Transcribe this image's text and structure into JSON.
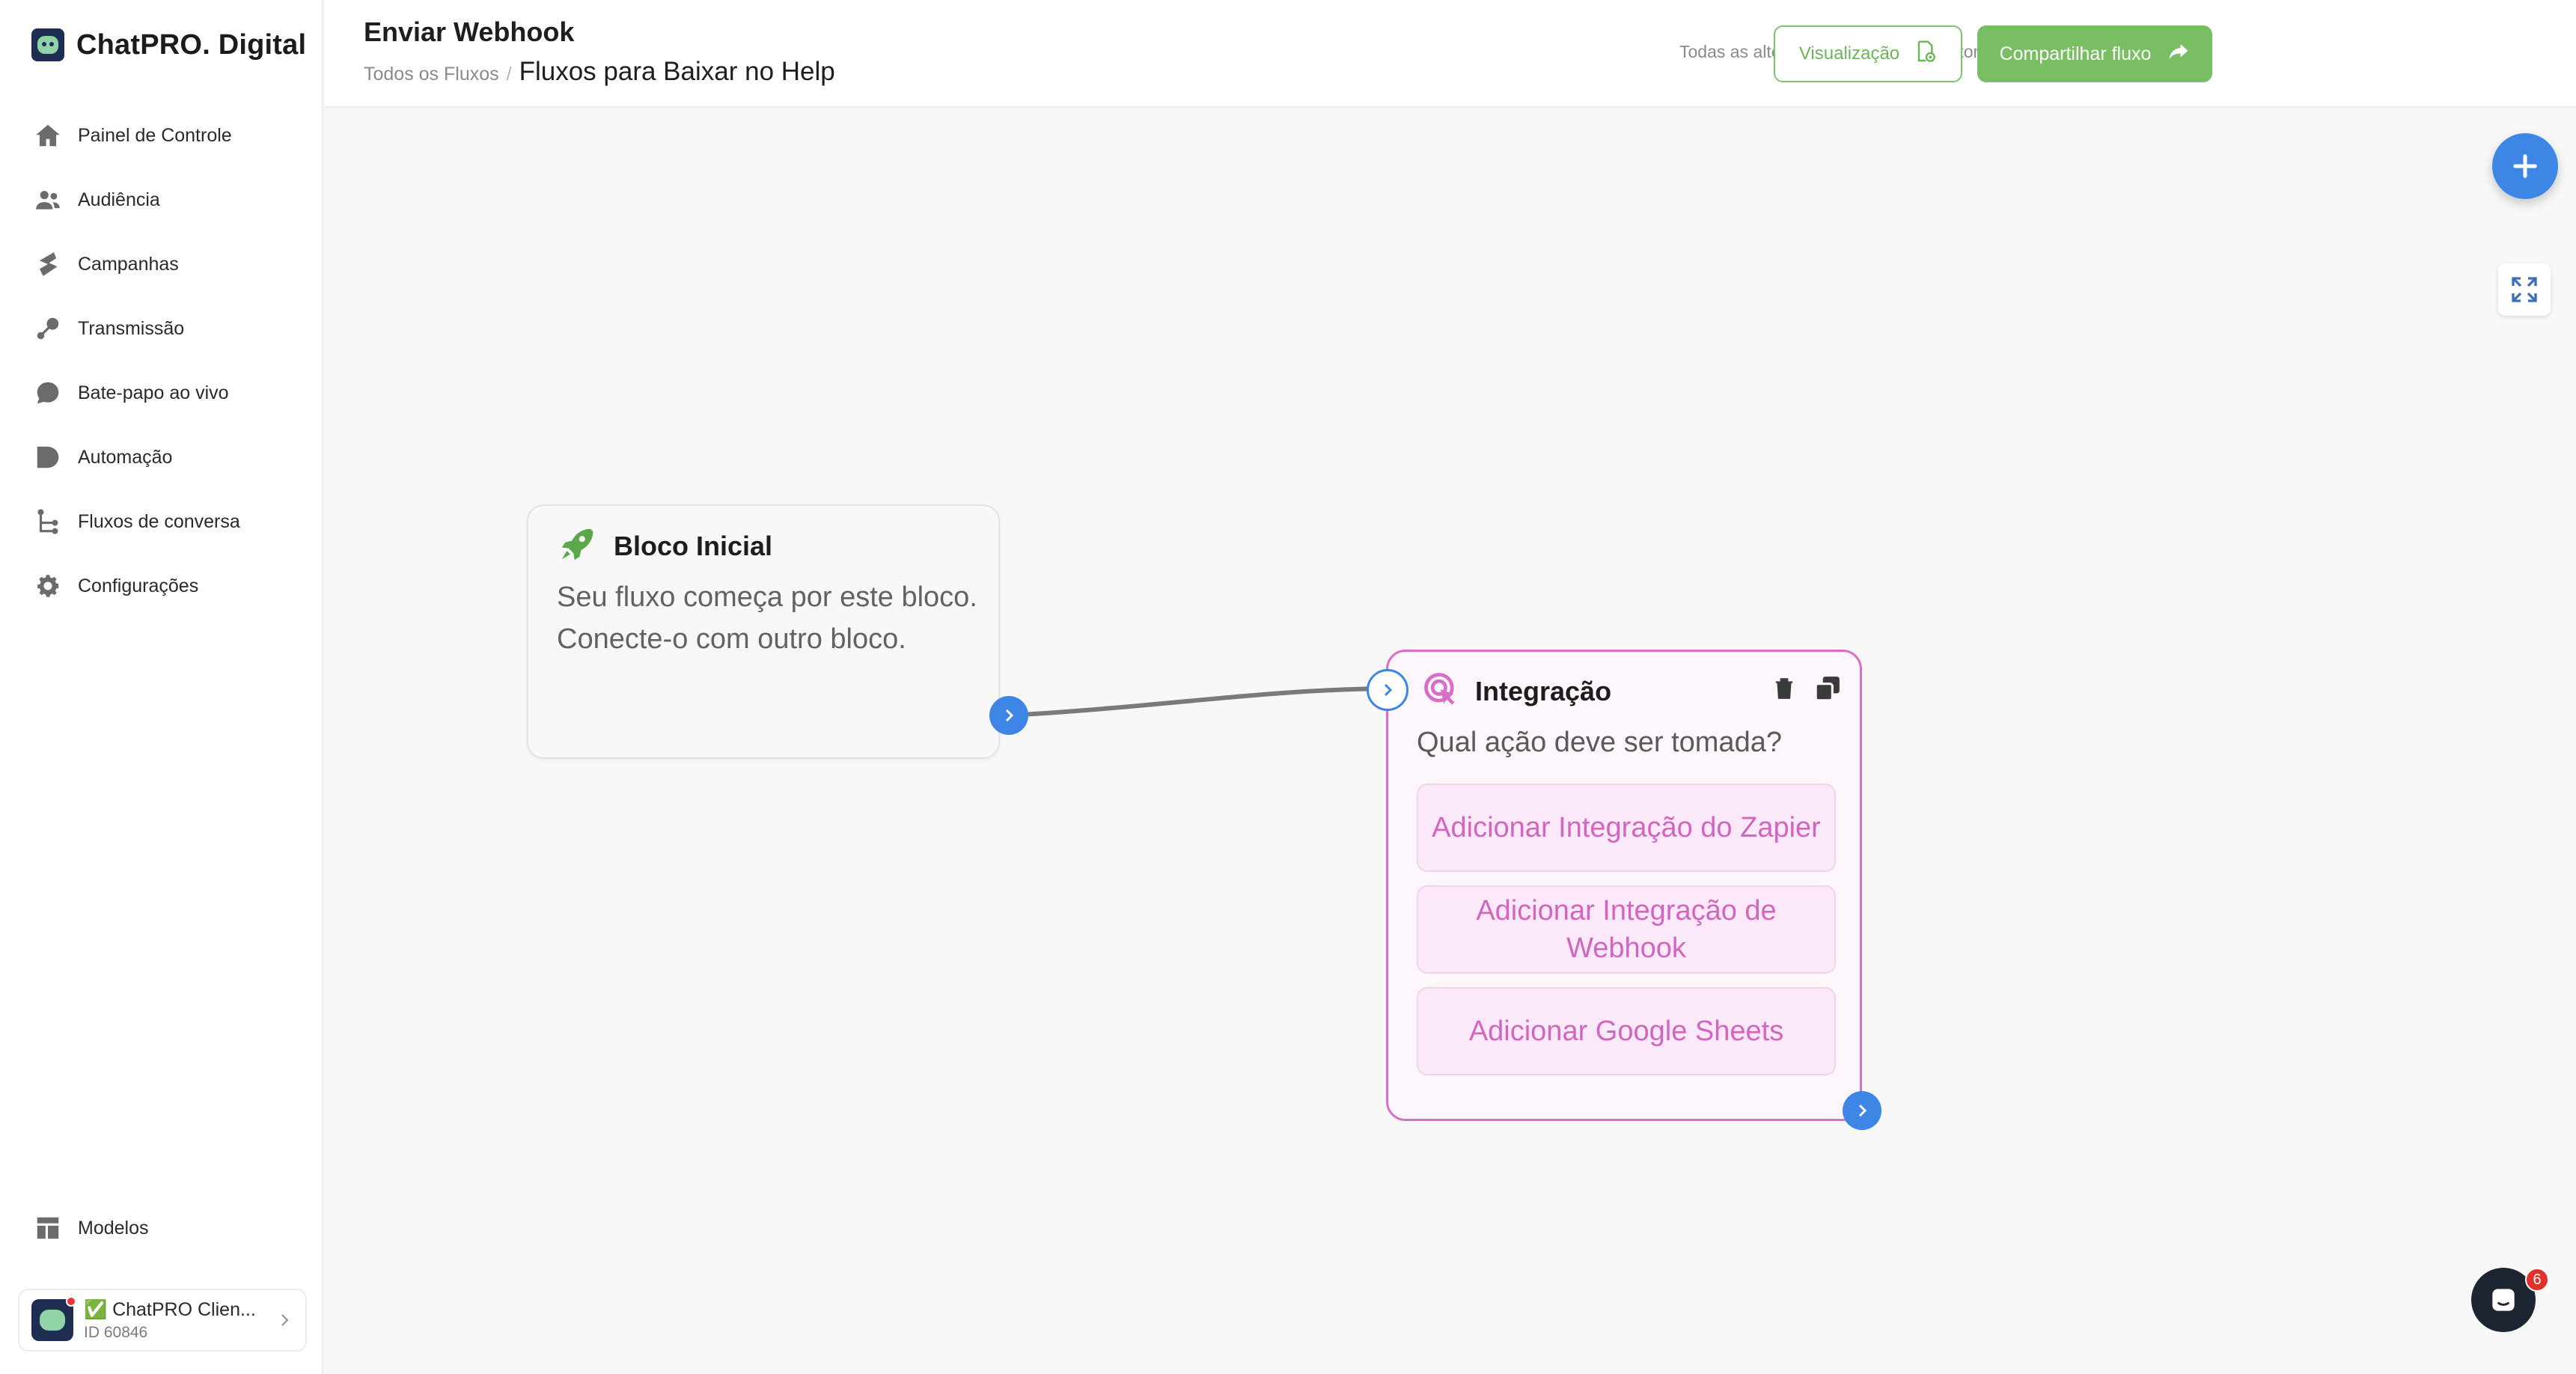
{
  "brand": {
    "name": "ChatPRO. Digital"
  },
  "nav": {
    "items": [
      {
        "label": "Painel de Controle",
        "icon": "home-icon"
      },
      {
        "label": "Audiência",
        "icon": "users-icon"
      },
      {
        "label": "Campanhas",
        "icon": "campaign-icon"
      },
      {
        "label": "Transmissão",
        "icon": "broadcast-icon"
      },
      {
        "label": "Bate-papo ao vivo",
        "icon": "chat-bubble-icon"
      },
      {
        "label": "Automação",
        "icon": "automation-icon"
      },
      {
        "label": "Fluxos de conversa",
        "icon": "flow-icon"
      },
      {
        "label": "Configurações",
        "icon": "gear-icon"
      }
    ],
    "bottom": {
      "label": "Modelos",
      "icon": "templates-icon"
    }
  },
  "account": {
    "name": "✅ ChatPRO Clien...",
    "id": "ID 60846"
  },
  "header": {
    "title": "Enviar Webhook",
    "breadcrumb_root": "Todos os Fluxos",
    "breadcrumb_sep": "/",
    "breadcrumb_current": "Fluxos para Baixar no Help",
    "save_status": "Todas as alterações foram salvas automaticamente",
    "preview_label": "Visualização",
    "share_label": "Compartilhar fluxo"
  },
  "nodes": {
    "start": {
      "title": "Bloco Inicial",
      "description": "Seu fluxo começa por este bloco. Conecte-o com outro bloco."
    },
    "integration": {
      "title": "Integração",
      "question": "Qual ação deve ser tomada?",
      "options": [
        "Adicionar Integração do Zapier",
        "Adicionar Integração de Webhook",
        "Adicionar Google Sheets"
      ]
    }
  },
  "chat": {
    "badge": "6"
  },
  "colors": {
    "accent_blue": "#3d86e6",
    "green": "#79be62",
    "integration_pink": "#d76fc7"
  }
}
